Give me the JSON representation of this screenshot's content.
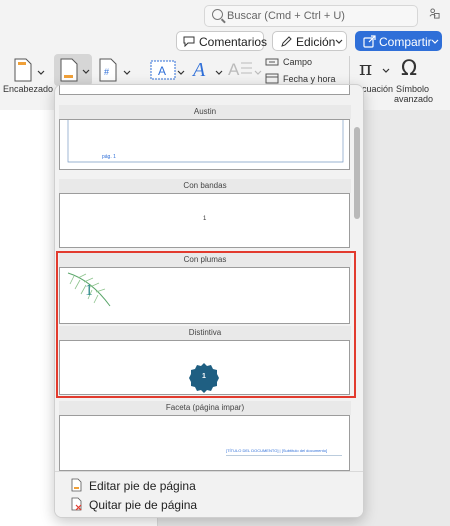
{
  "search": {
    "placeholder": "Buscar (Cmd + Ctrl + U)"
  },
  "toolbar": {
    "comments_label": "Comentarios",
    "edit_label": "Edición",
    "share_label": "Compartir"
  },
  "ribbon": {
    "header_label": "Encabezado",
    "field_label": "Campo",
    "datetime_label": "Fecha y hora",
    "equation_label": "ecuación",
    "symbol_label_1": "Símbolo",
    "symbol_label_2": "avanzado"
  },
  "gallery": {
    "items": [
      {
        "title": "Austin",
        "sample": "pág. 1"
      },
      {
        "title": "Con bandas",
        "sample": "1"
      },
      {
        "title": "Con plumas",
        "sample": "1"
      },
      {
        "title": "Distintiva",
        "sample": "1"
      },
      {
        "title": "Faceta (página impar)",
        "sample": "[TÍTULO DEL DOCUMENTO] | [Subtítulo del documento]"
      }
    ]
  },
  "footer_menu": {
    "edit_label": "Editar pie de página",
    "remove_label": "Quitar pie de página"
  },
  "colors": {
    "accent": "#2f6fd8",
    "selection": "#e23b2e",
    "distintiva": "#1f5f82",
    "plumas": "#2f8a8a"
  }
}
